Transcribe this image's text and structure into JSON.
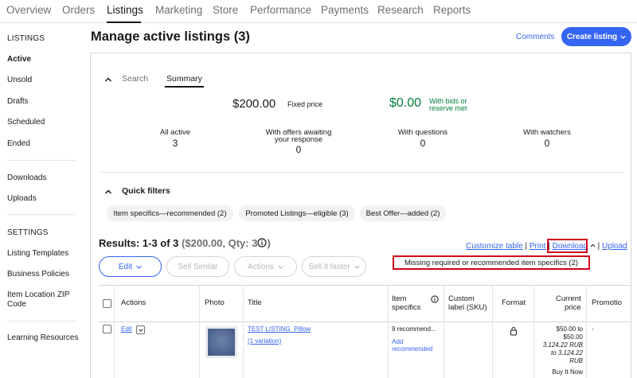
{
  "nav": {
    "tabs": [
      "Overview",
      "Orders",
      "Listings",
      "Marketing",
      "Store",
      "Performance",
      "Payments",
      "Research",
      "Reports"
    ],
    "active_tab": "Listings"
  },
  "sidebar": {
    "listings_heading": "LISTINGS",
    "listings_items": [
      "Active",
      "Unsold",
      "Drafts",
      "Scheduled",
      "Ended"
    ],
    "active_item": "Active",
    "transfer_items": [
      "Downloads",
      "Uploads"
    ],
    "settings_heading": "SETTINGS",
    "settings_items": [
      "Listing Templates",
      "Business Policies",
      "Item Location ZIP",
      "Code"
    ],
    "resources_item": "Learning Resources"
  },
  "header": {
    "title": "Manage active listings (3)",
    "comments_label": "Comments",
    "create_label": "Create listing"
  },
  "summary": {
    "tab_search": "Search",
    "tab_summary": "Summary",
    "fixed_price_value": "$200.00",
    "fixed_price_label": "Fixed price",
    "bids_value": "$0.00",
    "bids_label_1": "With bids or",
    "bids_label_2": "reserve met",
    "stats": [
      {
        "label_1": "All active",
        "label_2": "",
        "value": "3"
      },
      {
        "label_1": "With offers awaiting",
        "label_2": "your response",
        "value": "0"
      },
      {
        "label_1": "With questions",
        "label_2": "",
        "value": "0"
      },
      {
        "label_1": "With watchers",
        "label_2": "",
        "value": "0"
      }
    ]
  },
  "quick_filters": {
    "title": "Quick filters",
    "chips": [
      "Item specifics—recommended (2)",
      "Promoted Listings—eligible (3)",
      "Best Offer—added (2)"
    ]
  },
  "results": {
    "label": "Results: 1-3 of 3",
    "summary": "($200.00, Qty: 3",
    "links": {
      "customize": "Customize table",
      "print": "Print",
      "download": "Download",
      "upload": "Upload"
    },
    "buttons": {
      "edit": "Edit",
      "sell_similar": "Sell Similar",
      "actions": "Actions",
      "sell_faster": "Sell it faster"
    },
    "missing_notice": "Missing required or recommended item specifics (2)"
  },
  "table": {
    "columns": {
      "actions": "Actions",
      "photo": "Photo",
      "title": "Title",
      "item_specifics_1": "Item",
      "item_specifics_2": "specifics",
      "custom_label_1": "Custom",
      "custom_label_2": "label (SKU)",
      "format": "Format",
      "price_1": "Current",
      "price_2": "price",
      "promotion": "Promotio"
    },
    "rows": [
      {
        "edit": "Edit",
        "title": "TEST LISTING_Pillow",
        "variation": "(1 variation)",
        "specifics": "9 recommend...",
        "add_1": "Add",
        "add_2": "recommended",
        "price_1": "$50.00 to",
        "price_2": "$50.00",
        "price_rub_1": "3,124.22 RUB",
        "price_rub_2": "to 3,124.22",
        "price_rub_3": "RUB",
        "buy_it_now": "Buy It Now",
        "promotion": "-"
      }
    ]
  },
  "colors": {
    "accent": "#3665f3",
    "green": "#05823f",
    "highlight_red": "#d0021b",
    "chip_bg": "#f2f2f2"
  }
}
